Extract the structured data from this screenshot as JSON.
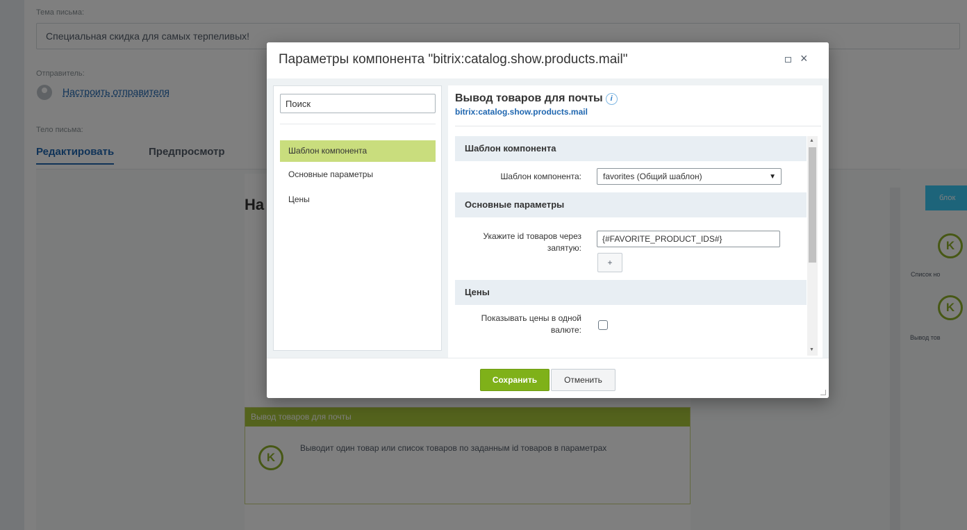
{
  "background": {
    "subject_label": "Тема письма:",
    "subject_value": "Специальная скидка для самых терпеливых!",
    "sender_label": "Отправитель:",
    "sender_link": "Настроить отправителя",
    "body_label": "Тело письма:",
    "tab_edit": "Редактировать",
    "tab_preview": "Предпросмотр",
    "heading_partial": "На",
    "block_title": "Вывод товаров для почты",
    "block_icon": "K",
    "block_desc": "Выводит один товар или список товаров по заданным id товаров в параметрах",
    "right_button": "блок",
    "right_label_1": "Список но",
    "right_label_2": "Вывод тов",
    "right_icon": "K",
    "accent_color": "#2067b0",
    "green_color": "#a8c63b"
  },
  "dialog": {
    "title": "Параметры компонента \"bitrix:catalog.show.products.mail\"",
    "close_glyph": "×",
    "search_placeholder": "Поиск",
    "nav": [
      "Шаблон компонента",
      "Основные параметры",
      "Цены"
    ],
    "component_title": "Вывод товаров для почты",
    "info_glyph": "i",
    "component_code": "bitrix:catalog.show.products.mail",
    "sections": {
      "template_head": "Шаблон компонента",
      "template_label": "Шаблон компонента:",
      "template_value": "favorites (Общий шаблон)",
      "main_head": "Основные параметры",
      "ids_label": "Укажите id товаров через запятую:",
      "ids_value": "{#FAVORITE_PRODUCT_IDS#}",
      "plus_label": "+",
      "prices_head": "Цены",
      "one_currency_label": "Показывать цены в одной валюте:"
    },
    "save_label": "Сохранить",
    "cancel_label": "Отменить",
    "save_color": "#7fb119"
  }
}
